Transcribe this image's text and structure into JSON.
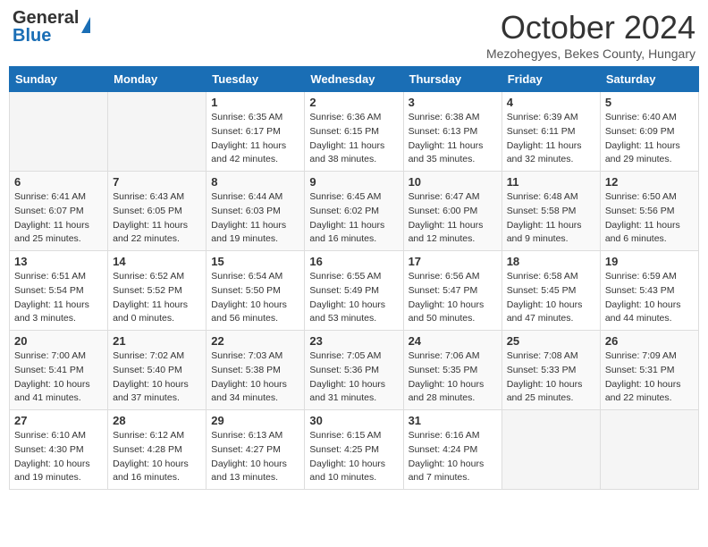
{
  "header": {
    "logo_line1": "General",
    "logo_line2": "Blue",
    "month_title": "October 2024",
    "location": "Mezohegyes, Bekes County, Hungary"
  },
  "days_of_week": [
    "Sunday",
    "Monday",
    "Tuesday",
    "Wednesday",
    "Thursday",
    "Friday",
    "Saturday"
  ],
  "weeks": [
    [
      {
        "day": "",
        "info": ""
      },
      {
        "day": "",
        "info": ""
      },
      {
        "day": "1",
        "info": "Sunrise: 6:35 AM\nSunset: 6:17 PM\nDaylight: 11 hours and 42 minutes."
      },
      {
        "day": "2",
        "info": "Sunrise: 6:36 AM\nSunset: 6:15 PM\nDaylight: 11 hours and 38 minutes."
      },
      {
        "day": "3",
        "info": "Sunrise: 6:38 AM\nSunset: 6:13 PM\nDaylight: 11 hours and 35 minutes."
      },
      {
        "day": "4",
        "info": "Sunrise: 6:39 AM\nSunset: 6:11 PM\nDaylight: 11 hours and 32 minutes."
      },
      {
        "day": "5",
        "info": "Sunrise: 6:40 AM\nSunset: 6:09 PM\nDaylight: 11 hours and 29 minutes."
      }
    ],
    [
      {
        "day": "6",
        "info": "Sunrise: 6:41 AM\nSunset: 6:07 PM\nDaylight: 11 hours and 25 minutes."
      },
      {
        "day": "7",
        "info": "Sunrise: 6:43 AM\nSunset: 6:05 PM\nDaylight: 11 hours and 22 minutes."
      },
      {
        "day": "8",
        "info": "Sunrise: 6:44 AM\nSunset: 6:03 PM\nDaylight: 11 hours and 19 minutes."
      },
      {
        "day": "9",
        "info": "Sunrise: 6:45 AM\nSunset: 6:02 PM\nDaylight: 11 hours and 16 minutes."
      },
      {
        "day": "10",
        "info": "Sunrise: 6:47 AM\nSunset: 6:00 PM\nDaylight: 11 hours and 12 minutes."
      },
      {
        "day": "11",
        "info": "Sunrise: 6:48 AM\nSunset: 5:58 PM\nDaylight: 11 hours and 9 minutes."
      },
      {
        "day": "12",
        "info": "Sunrise: 6:50 AM\nSunset: 5:56 PM\nDaylight: 11 hours and 6 minutes."
      }
    ],
    [
      {
        "day": "13",
        "info": "Sunrise: 6:51 AM\nSunset: 5:54 PM\nDaylight: 11 hours and 3 minutes."
      },
      {
        "day": "14",
        "info": "Sunrise: 6:52 AM\nSunset: 5:52 PM\nDaylight: 11 hours and 0 minutes."
      },
      {
        "day": "15",
        "info": "Sunrise: 6:54 AM\nSunset: 5:50 PM\nDaylight: 10 hours and 56 minutes."
      },
      {
        "day": "16",
        "info": "Sunrise: 6:55 AM\nSunset: 5:49 PM\nDaylight: 10 hours and 53 minutes."
      },
      {
        "day": "17",
        "info": "Sunrise: 6:56 AM\nSunset: 5:47 PM\nDaylight: 10 hours and 50 minutes."
      },
      {
        "day": "18",
        "info": "Sunrise: 6:58 AM\nSunset: 5:45 PM\nDaylight: 10 hours and 47 minutes."
      },
      {
        "day": "19",
        "info": "Sunrise: 6:59 AM\nSunset: 5:43 PM\nDaylight: 10 hours and 44 minutes."
      }
    ],
    [
      {
        "day": "20",
        "info": "Sunrise: 7:00 AM\nSunset: 5:41 PM\nDaylight: 10 hours and 41 minutes."
      },
      {
        "day": "21",
        "info": "Sunrise: 7:02 AM\nSunset: 5:40 PM\nDaylight: 10 hours and 37 minutes."
      },
      {
        "day": "22",
        "info": "Sunrise: 7:03 AM\nSunset: 5:38 PM\nDaylight: 10 hours and 34 minutes."
      },
      {
        "day": "23",
        "info": "Sunrise: 7:05 AM\nSunset: 5:36 PM\nDaylight: 10 hours and 31 minutes."
      },
      {
        "day": "24",
        "info": "Sunrise: 7:06 AM\nSunset: 5:35 PM\nDaylight: 10 hours and 28 minutes."
      },
      {
        "day": "25",
        "info": "Sunrise: 7:08 AM\nSunset: 5:33 PM\nDaylight: 10 hours and 25 minutes."
      },
      {
        "day": "26",
        "info": "Sunrise: 7:09 AM\nSunset: 5:31 PM\nDaylight: 10 hours and 22 minutes."
      }
    ],
    [
      {
        "day": "27",
        "info": "Sunrise: 6:10 AM\nSunset: 4:30 PM\nDaylight: 10 hours and 19 minutes."
      },
      {
        "day": "28",
        "info": "Sunrise: 6:12 AM\nSunset: 4:28 PM\nDaylight: 10 hours and 16 minutes."
      },
      {
        "day": "29",
        "info": "Sunrise: 6:13 AM\nSunset: 4:27 PM\nDaylight: 10 hours and 13 minutes."
      },
      {
        "day": "30",
        "info": "Sunrise: 6:15 AM\nSunset: 4:25 PM\nDaylight: 10 hours and 10 minutes."
      },
      {
        "day": "31",
        "info": "Sunrise: 6:16 AM\nSunset: 4:24 PM\nDaylight: 10 hours and 7 minutes."
      },
      {
        "day": "",
        "info": ""
      },
      {
        "day": "",
        "info": ""
      }
    ]
  ]
}
